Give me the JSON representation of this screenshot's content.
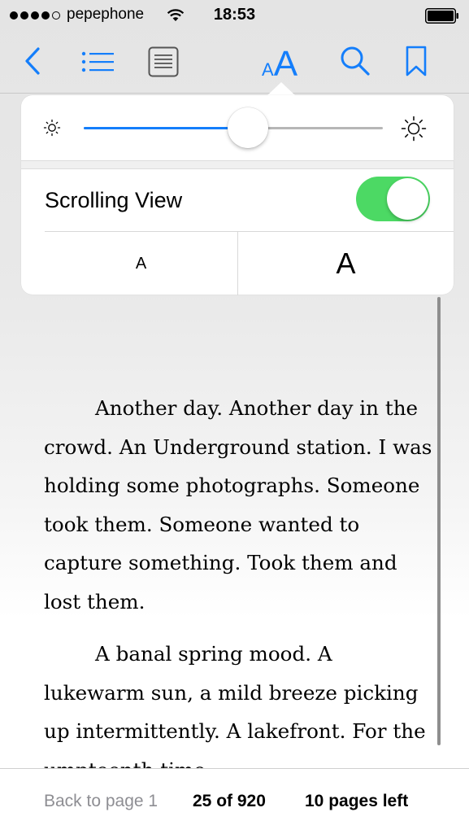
{
  "status_bar": {
    "carrier": "pepephone",
    "time": "18:53",
    "signal_bars_filled": 4,
    "signal_bars_total": 5
  },
  "toolbar": {
    "icons": [
      "back-chevron-icon",
      "table-of-contents-icon",
      "library-icon",
      "font-size-icon",
      "search-icon",
      "bookmark-icon"
    ],
    "font_button_small": "A",
    "font_button_large": "A"
  },
  "popover": {
    "brightness": 0.55,
    "scrolling_view_label": "Scrolling View",
    "scrolling_view_on": true,
    "font_smaller_label": "A",
    "font_larger_label": "A"
  },
  "book": {
    "paragraphs": [
      "Another day. Another day in the crowd. An Underground station. I was holding some photographs. Someone took them. Someone wanted to capture something. Took them and lost them.",
      "A banal spring mood. A lukewarm sun, a mild breeze picking up intermittently. A lakefront. For the umpteenth time"
    ]
  },
  "footer": {
    "back_link": "Back to page 1",
    "page_count": "25 of 920",
    "pages_left": "10 pages left"
  },
  "colors": {
    "accent": "#147efb",
    "toggle_on": "#4cd964",
    "secondary_text": "#8e8e93"
  }
}
